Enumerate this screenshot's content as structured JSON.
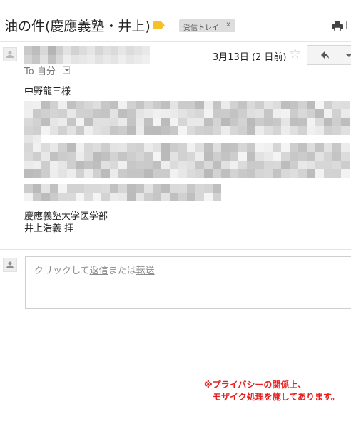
{
  "header": {
    "subject": "油の件(慶應義塾・井上)",
    "inbox_chip_label": "受信トレイ",
    "inbox_chip_close": "x",
    "extra_icon_glyph": "l"
  },
  "message": {
    "date": "3月13日 (2 日前)",
    "to_line": "To 自分",
    "greeting": "中野龍三様",
    "signature_line1": "慶應義塾大学医学部",
    "signature_line2": "井上浩義  拝"
  },
  "reply": {
    "prompt_prefix": "クリックして",
    "reply_link": "返信",
    "prompt_middle": "または",
    "forward_link": "転送"
  },
  "notice": {
    "line1": "※プライバシーの関係上、",
    "line2": "モザイク処理を施してあります。"
  },
  "colors": {
    "label_tag": "#f6c026",
    "notice_red": "#e8201f",
    "chip_bg": "#dddddd"
  },
  "icons": {
    "label": "label-tag-icon",
    "print": "print-icon",
    "avatar": "person-icon",
    "star": "star-icon",
    "reply": "reply-arrow-icon",
    "more": "chevron-down-icon"
  }
}
